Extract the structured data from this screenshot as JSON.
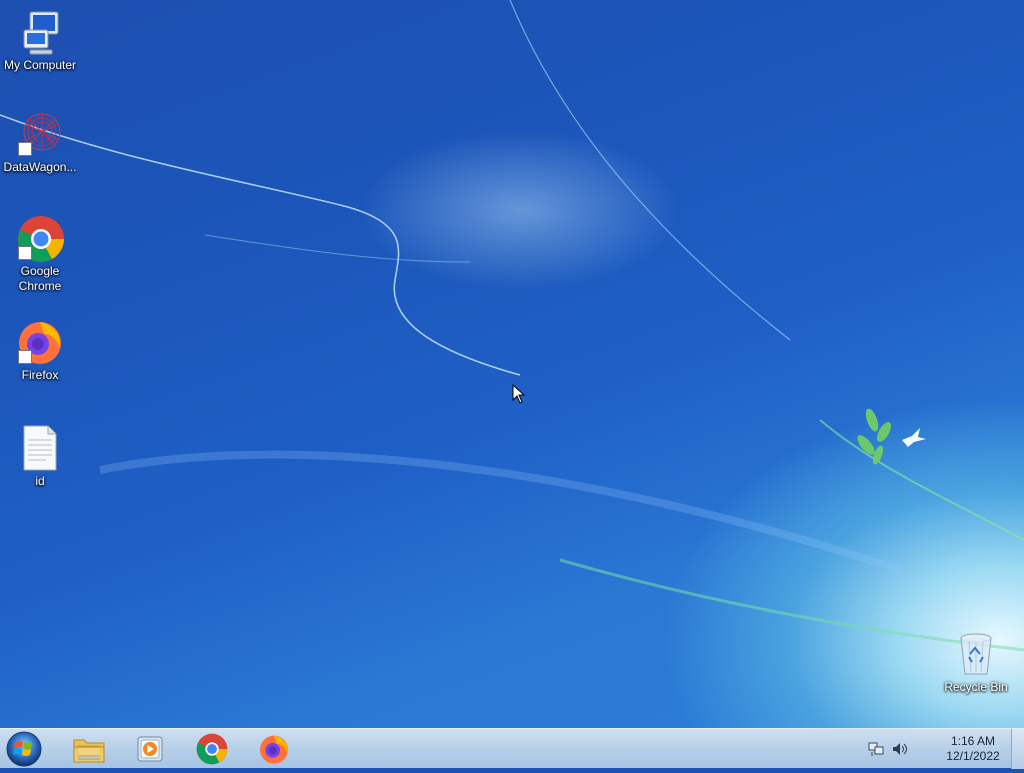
{
  "desktop": {
    "icons": [
      {
        "id": "my-computer",
        "label": "My Computer",
        "icon": "computer-icon"
      },
      {
        "id": "datawagon",
        "label": "DataWagon...",
        "icon": "datawagon-icon"
      },
      {
        "id": "google-chrome",
        "label": "Google Chrome",
        "icon": "chrome-icon"
      },
      {
        "id": "firefox",
        "label": "Firefox",
        "icon": "firefox-icon"
      },
      {
        "id": "id-file",
        "label": "id",
        "icon": "text-file-icon"
      },
      {
        "id": "recycle-bin",
        "label": "Recycle Bin",
        "icon": "recycle-bin-icon"
      }
    ]
  },
  "taskbar": {
    "start": {
      "icon": "windows-start-icon"
    },
    "pinned": [
      {
        "name": "File Explorer",
        "icon": "folder-icon"
      },
      {
        "name": "Windows Media Player",
        "icon": "media-player-icon"
      },
      {
        "name": "Google Chrome",
        "icon": "chrome-icon"
      },
      {
        "name": "Firefox",
        "icon": "firefox-icon"
      }
    ],
    "tray": {
      "icons": [
        "network-icon",
        "volume-icon"
      ],
      "time": "1:16 AM",
      "date": "12/1/2022"
    }
  },
  "colors": {
    "accent": "#1d4fb0",
    "taskbar": "#b9d1ea"
  }
}
